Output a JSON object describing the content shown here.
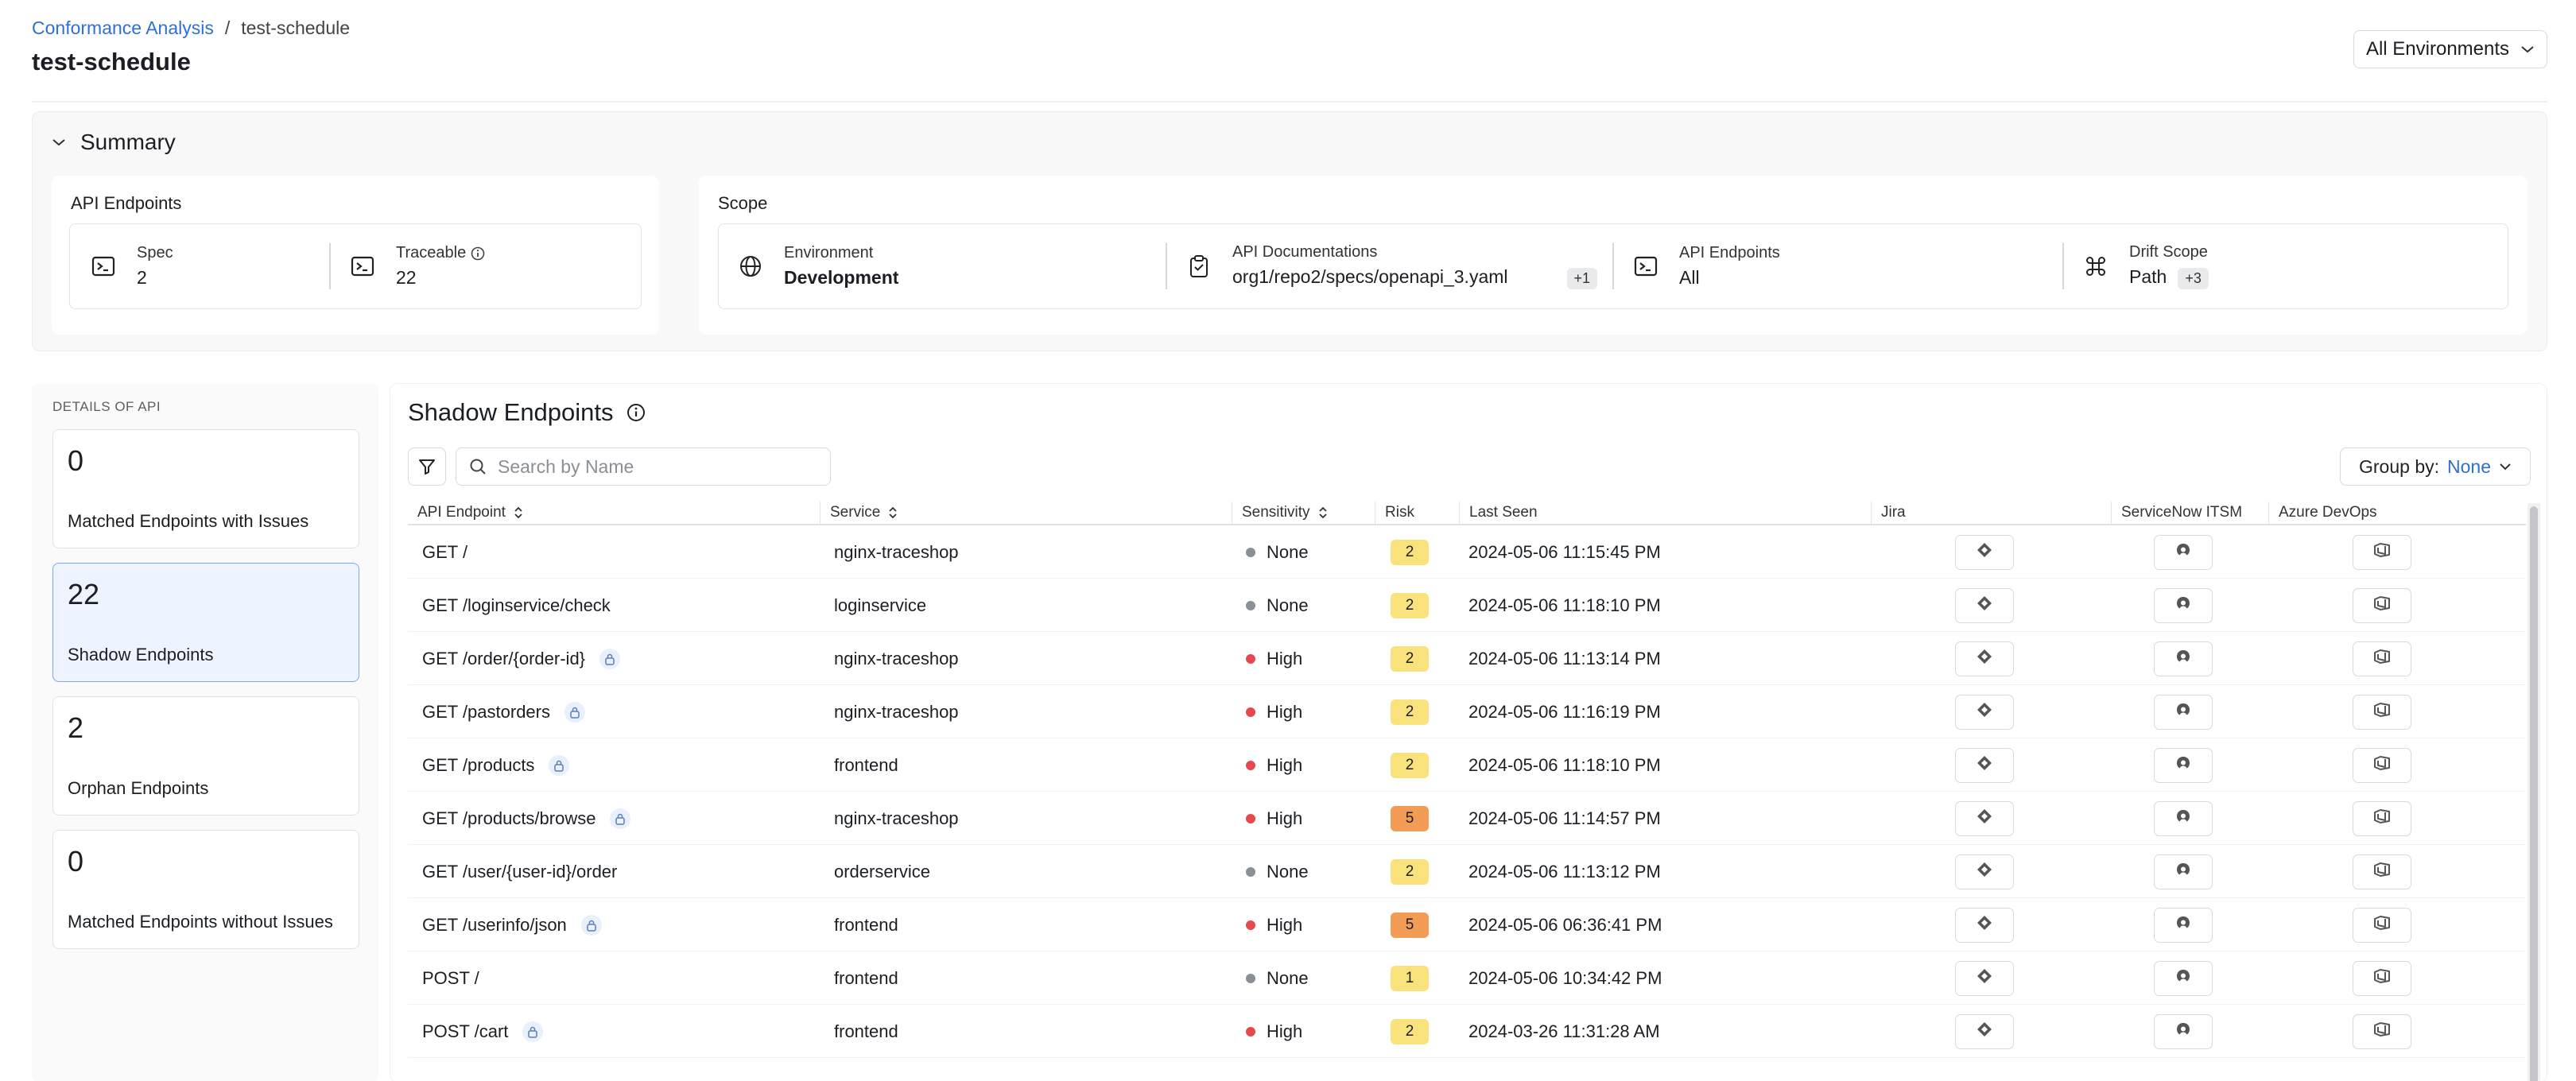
{
  "breadcrumb": {
    "parent": "Conformance Analysis",
    "separator": "/",
    "current": "test-schedule"
  },
  "page": {
    "title": "test-schedule"
  },
  "environment_select": {
    "value": "All Environments"
  },
  "summary": {
    "title": "Summary",
    "api_endpoints": {
      "title": "API Endpoints",
      "spec_label": "Spec",
      "spec_value": "2",
      "traceable_label": "Traceable",
      "traceable_value": "22"
    },
    "scope": {
      "title": "Scope",
      "environment_label": "Environment",
      "environment_value": "Development",
      "docs_label": "API Documentations",
      "docs_value": "org1/repo2/specs/openapi_3.yaml",
      "docs_extra": "+1",
      "endpoints_label": "API Endpoints",
      "endpoints_value": "All",
      "drift_label": "Drift Scope",
      "drift_value": "Path",
      "drift_extra": "+3"
    }
  },
  "details": {
    "title": "DETAILS OF API",
    "cards": [
      {
        "count": "0",
        "label": "Matched Endpoints with Issues",
        "active": false
      },
      {
        "count": "22",
        "label": "Shadow Endpoints",
        "active": true
      },
      {
        "count": "2",
        "label": "Orphan Endpoints",
        "active": false
      },
      {
        "count": "0",
        "label": "Matched Endpoints without Issues",
        "active": false
      }
    ]
  },
  "shadow": {
    "title": "Shadow Endpoints",
    "search_placeholder": "Search by Name",
    "group_by_label": "Group by:",
    "group_by_value": "None",
    "columns": {
      "endpoint": "API Endpoint",
      "service": "Service",
      "sensitivity": "Sensitivity",
      "risk": "Risk",
      "last_seen": "Last Seen",
      "jira": "Jira",
      "servicenow": "ServiceNow ITSM",
      "azure": "Azure DevOps"
    },
    "rows": [
      {
        "endpoint": "GET /",
        "locked": false,
        "service": "nginx-traceshop",
        "sensitivity": "None",
        "risk": "2",
        "last_seen": "2024-05-06 11:15:45 PM"
      },
      {
        "endpoint": "GET /loginservice/check",
        "locked": false,
        "service": "loginservice",
        "sensitivity": "None",
        "risk": "2",
        "last_seen": "2024-05-06 11:18:10 PM"
      },
      {
        "endpoint": "GET /order/{order-id}",
        "locked": true,
        "service": "nginx-traceshop",
        "sensitivity": "High",
        "risk": "2",
        "last_seen": "2024-05-06 11:13:14 PM"
      },
      {
        "endpoint": "GET /pastorders",
        "locked": true,
        "service": "nginx-traceshop",
        "sensitivity": "High",
        "risk": "2",
        "last_seen": "2024-05-06 11:16:19 PM"
      },
      {
        "endpoint": "GET /products",
        "locked": true,
        "service": "frontend",
        "sensitivity": "High",
        "risk": "2",
        "last_seen": "2024-05-06 11:18:10 PM"
      },
      {
        "endpoint": "GET /products/browse",
        "locked": true,
        "service": "nginx-traceshop",
        "sensitivity": "High",
        "risk": "5",
        "last_seen": "2024-05-06 11:14:57 PM"
      },
      {
        "endpoint": "GET /user/{user-id}/order",
        "locked": false,
        "service": "orderservice",
        "sensitivity": "None",
        "risk": "2",
        "last_seen": "2024-05-06 11:13:12 PM"
      },
      {
        "endpoint": "GET /userinfo/json",
        "locked": true,
        "service": "frontend",
        "sensitivity": "High",
        "risk": "5",
        "last_seen": "2024-05-06 06:36:41 PM"
      },
      {
        "endpoint": "POST /",
        "locked": false,
        "service": "frontend",
        "sensitivity": "None",
        "risk": "1",
        "last_seen": "2024-05-06 10:34:42 PM"
      },
      {
        "endpoint": "POST /cart",
        "locked": true,
        "service": "frontend",
        "sensitivity": "High",
        "risk": "2",
        "last_seen": "2024-03-26 11:31:28 AM"
      }
    ]
  },
  "colors": {
    "link": "#2f6fd6",
    "sensitivity_high": "#e5484d",
    "sensitivity_none": "#8b8f96",
    "risk_low": "#f9e27c",
    "risk_high": "#f29c55",
    "active_card_bg": "#eef4ff"
  }
}
